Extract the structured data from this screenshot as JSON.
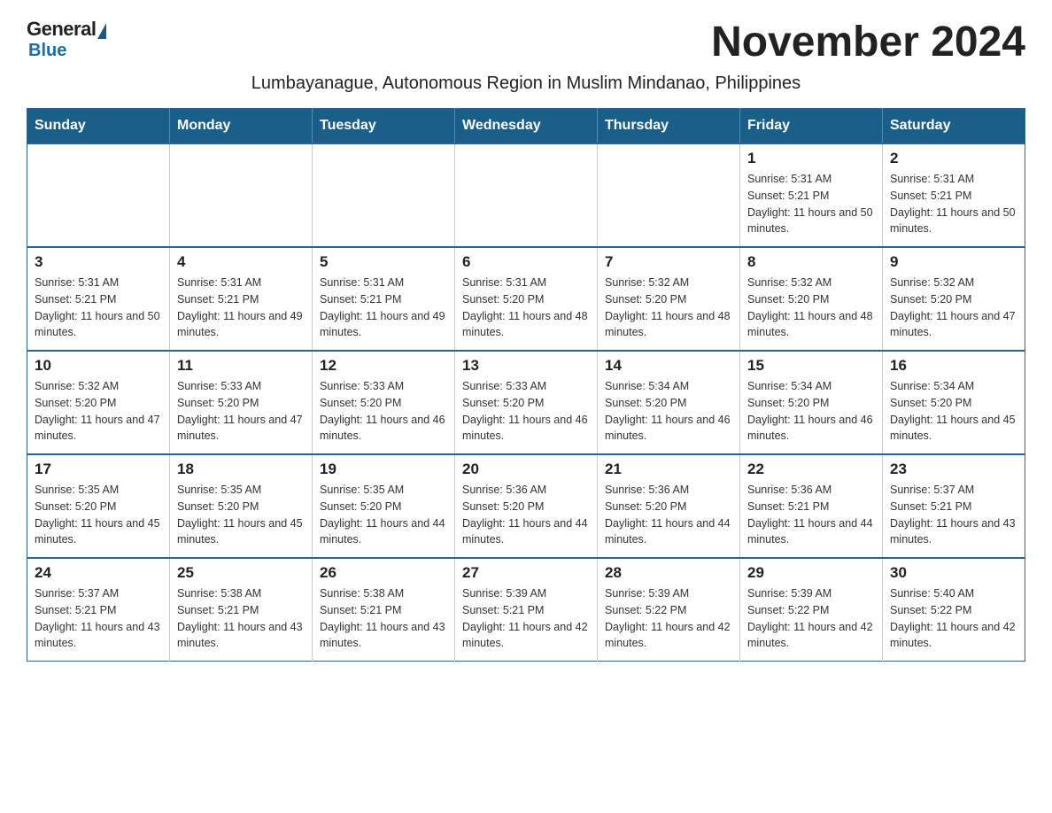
{
  "logo": {
    "general": "General",
    "blue": "Blue"
  },
  "title": "November 2024",
  "subtitle": "Lumbayanague, Autonomous Region in Muslim Mindanao, Philippines",
  "weekdays": [
    "Sunday",
    "Monday",
    "Tuesday",
    "Wednesday",
    "Thursday",
    "Friday",
    "Saturday"
  ],
  "weeks": [
    [
      {
        "day": "",
        "info": ""
      },
      {
        "day": "",
        "info": ""
      },
      {
        "day": "",
        "info": ""
      },
      {
        "day": "",
        "info": ""
      },
      {
        "day": "",
        "info": ""
      },
      {
        "day": "1",
        "info": "Sunrise: 5:31 AM\nSunset: 5:21 PM\nDaylight: 11 hours and 50 minutes."
      },
      {
        "day": "2",
        "info": "Sunrise: 5:31 AM\nSunset: 5:21 PM\nDaylight: 11 hours and 50 minutes."
      }
    ],
    [
      {
        "day": "3",
        "info": "Sunrise: 5:31 AM\nSunset: 5:21 PM\nDaylight: 11 hours and 50 minutes."
      },
      {
        "day": "4",
        "info": "Sunrise: 5:31 AM\nSunset: 5:21 PM\nDaylight: 11 hours and 49 minutes."
      },
      {
        "day": "5",
        "info": "Sunrise: 5:31 AM\nSunset: 5:21 PM\nDaylight: 11 hours and 49 minutes."
      },
      {
        "day": "6",
        "info": "Sunrise: 5:31 AM\nSunset: 5:20 PM\nDaylight: 11 hours and 48 minutes."
      },
      {
        "day": "7",
        "info": "Sunrise: 5:32 AM\nSunset: 5:20 PM\nDaylight: 11 hours and 48 minutes."
      },
      {
        "day": "8",
        "info": "Sunrise: 5:32 AM\nSunset: 5:20 PM\nDaylight: 11 hours and 48 minutes."
      },
      {
        "day": "9",
        "info": "Sunrise: 5:32 AM\nSunset: 5:20 PM\nDaylight: 11 hours and 47 minutes."
      }
    ],
    [
      {
        "day": "10",
        "info": "Sunrise: 5:32 AM\nSunset: 5:20 PM\nDaylight: 11 hours and 47 minutes."
      },
      {
        "day": "11",
        "info": "Sunrise: 5:33 AM\nSunset: 5:20 PM\nDaylight: 11 hours and 47 minutes."
      },
      {
        "day": "12",
        "info": "Sunrise: 5:33 AM\nSunset: 5:20 PM\nDaylight: 11 hours and 46 minutes."
      },
      {
        "day": "13",
        "info": "Sunrise: 5:33 AM\nSunset: 5:20 PM\nDaylight: 11 hours and 46 minutes."
      },
      {
        "day": "14",
        "info": "Sunrise: 5:34 AM\nSunset: 5:20 PM\nDaylight: 11 hours and 46 minutes."
      },
      {
        "day": "15",
        "info": "Sunrise: 5:34 AM\nSunset: 5:20 PM\nDaylight: 11 hours and 46 minutes."
      },
      {
        "day": "16",
        "info": "Sunrise: 5:34 AM\nSunset: 5:20 PM\nDaylight: 11 hours and 45 minutes."
      }
    ],
    [
      {
        "day": "17",
        "info": "Sunrise: 5:35 AM\nSunset: 5:20 PM\nDaylight: 11 hours and 45 minutes."
      },
      {
        "day": "18",
        "info": "Sunrise: 5:35 AM\nSunset: 5:20 PM\nDaylight: 11 hours and 45 minutes."
      },
      {
        "day": "19",
        "info": "Sunrise: 5:35 AM\nSunset: 5:20 PM\nDaylight: 11 hours and 44 minutes."
      },
      {
        "day": "20",
        "info": "Sunrise: 5:36 AM\nSunset: 5:20 PM\nDaylight: 11 hours and 44 minutes."
      },
      {
        "day": "21",
        "info": "Sunrise: 5:36 AM\nSunset: 5:20 PM\nDaylight: 11 hours and 44 minutes."
      },
      {
        "day": "22",
        "info": "Sunrise: 5:36 AM\nSunset: 5:21 PM\nDaylight: 11 hours and 44 minutes."
      },
      {
        "day": "23",
        "info": "Sunrise: 5:37 AM\nSunset: 5:21 PM\nDaylight: 11 hours and 43 minutes."
      }
    ],
    [
      {
        "day": "24",
        "info": "Sunrise: 5:37 AM\nSunset: 5:21 PM\nDaylight: 11 hours and 43 minutes."
      },
      {
        "day": "25",
        "info": "Sunrise: 5:38 AM\nSunset: 5:21 PM\nDaylight: 11 hours and 43 minutes."
      },
      {
        "day": "26",
        "info": "Sunrise: 5:38 AM\nSunset: 5:21 PM\nDaylight: 11 hours and 43 minutes."
      },
      {
        "day": "27",
        "info": "Sunrise: 5:39 AM\nSunset: 5:21 PM\nDaylight: 11 hours and 42 minutes."
      },
      {
        "day": "28",
        "info": "Sunrise: 5:39 AM\nSunset: 5:22 PM\nDaylight: 11 hours and 42 minutes."
      },
      {
        "day": "29",
        "info": "Sunrise: 5:39 AM\nSunset: 5:22 PM\nDaylight: 11 hours and 42 minutes."
      },
      {
        "day": "30",
        "info": "Sunrise: 5:40 AM\nSunset: 5:22 PM\nDaylight: 11 hours and 42 minutes."
      }
    ]
  ]
}
